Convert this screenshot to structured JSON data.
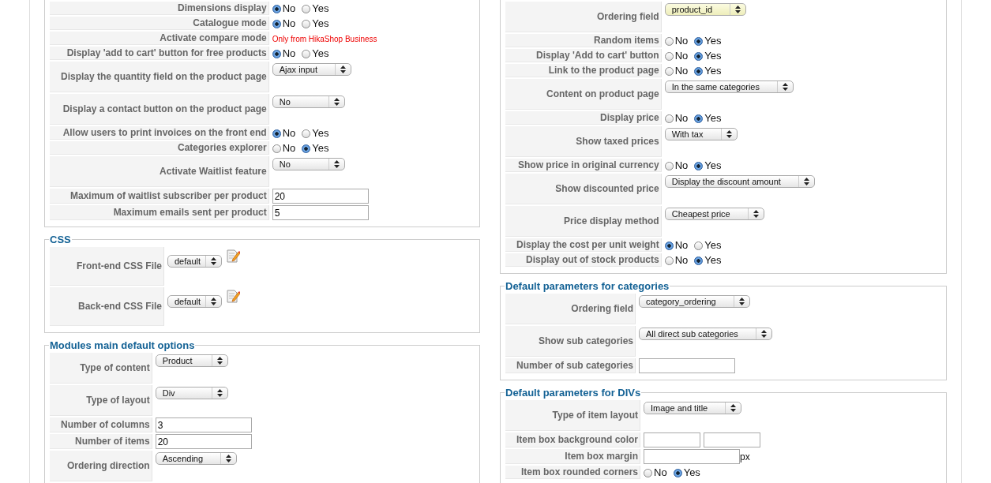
{
  "left": [
    {
      "rows": [
        {
          "kind": "radio",
          "label": "Dimensions display",
          "options": [
            {
              "label": "No",
              "selected": true
            },
            {
              "label": "Yes",
              "selected": false
            }
          ]
        },
        {
          "kind": "radio",
          "label": "Catalogue mode",
          "options": [
            {
              "label": "No",
              "selected": true
            },
            {
              "label": "Yes",
              "selected": false
            }
          ]
        },
        {
          "kind": "note",
          "label": "Activate compare mode",
          "note": "Only from HikaShop Business"
        },
        {
          "kind": "radio",
          "label": "Display 'add to cart' button for free products",
          "options": [
            {
              "label": "No",
              "selected": true
            },
            {
              "label": "Yes",
              "selected": false
            }
          ]
        },
        {
          "kind": "select",
          "label": "Display the quantity field on the product page",
          "value": "Ajax input"
        },
        {
          "kind": "select",
          "label": "Display a contact button on the product page",
          "value": "No"
        },
        {
          "kind": "radio",
          "label": "Allow users to print invoices on the front end",
          "options": [
            {
              "label": "No",
              "selected": true
            },
            {
              "label": "Yes",
              "selected": false
            }
          ]
        },
        {
          "kind": "radio",
          "label": "Categories explorer",
          "options": [
            {
              "label": "No",
              "selected": false
            },
            {
              "label": "Yes",
              "selected": true
            }
          ]
        },
        {
          "kind": "select",
          "label": "Activate Waitlist feature",
          "value": "No"
        },
        {
          "kind": "text",
          "label": "Maximum of waitlist subscriber per product",
          "value": "20"
        },
        {
          "kind": "text",
          "label": "Maximum emails sent per product",
          "value": "5"
        }
      ]
    },
    {
      "legend": "CSS",
      "rows": [
        {
          "kind": "css_file",
          "label": "Front-end CSS File",
          "value": "default"
        },
        {
          "kind": "css_file",
          "label": "Back-end CSS File",
          "value": "default"
        }
      ]
    },
    {
      "legend": "Modules main default options",
      "rows": [
        {
          "kind": "select",
          "label": "Type of content",
          "value": "Product"
        },
        {
          "kind": "select",
          "label": "Type of layout",
          "value": "Div"
        },
        {
          "kind": "text",
          "label": "Number of columns",
          "value": "3"
        },
        {
          "kind": "text",
          "label": "Number of items",
          "value": "20"
        },
        {
          "kind": "select",
          "label": "Ordering direction",
          "value": "Ascending"
        }
      ]
    }
  ],
  "right": [
    {
      "rows": [
        {
          "kind": "select",
          "label": "Ordering field",
          "value": "product_id",
          "highlighted": true
        },
        {
          "kind": "radio",
          "label": "Random items",
          "options": [
            {
              "label": "No",
              "selected": false
            },
            {
              "label": "Yes",
              "selected": true
            }
          ]
        },
        {
          "kind": "radio",
          "label": "Display 'Add to cart' button",
          "options": [
            {
              "label": "No",
              "selected": false
            },
            {
              "label": "Yes",
              "selected": true
            }
          ]
        },
        {
          "kind": "radio",
          "label": "Link to the product page",
          "options": [
            {
              "label": "No",
              "selected": false
            },
            {
              "label": "Yes",
              "selected": true
            }
          ]
        },
        {
          "kind": "select",
          "label": "Content on product page",
          "value": "In the same categories"
        },
        {
          "kind": "radio",
          "label": "Display price",
          "options": [
            {
              "label": "No",
              "selected": false
            },
            {
              "label": "Yes",
              "selected": true
            }
          ]
        },
        {
          "kind": "select",
          "label": "Show taxed prices",
          "value": "With tax"
        },
        {
          "kind": "radio",
          "label": "Show price in original currency",
          "options": [
            {
              "label": "No",
              "selected": false
            },
            {
              "label": "Yes",
              "selected": true
            }
          ]
        },
        {
          "kind": "select",
          "label": "Show discounted price",
          "value": "Display the discount amount"
        },
        {
          "kind": "select",
          "label": "Price display method",
          "value": "Cheapest price"
        },
        {
          "kind": "radio",
          "label": "Display the cost per unit weight",
          "options": [
            {
              "label": "No",
              "selected": true
            },
            {
              "label": "Yes",
              "selected": false
            }
          ]
        },
        {
          "kind": "radio",
          "label": "Display out of stock products",
          "options": [
            {
              "label": "No",
              "selected": false
            },
            {
              "label": "Yes",
              "selected": true
            }
          ]
        }
      ]
    },
    {
      "legend": "Default parameters for categories",
      "rows": [
        {
          "kind": "select",
          "label": "Ordering field",
          "value": "category_ordering"
        },
        {
          "kind": "select",
          "label": "Show sub categories",
          "value": "All direct sub categories"
        },
        {
          "kind": "text",
          "label": "Number of sub categories"
        }
      ]
    },
    {
      "legend": "Default parameters for DIVs",
      "rows": [
        {
          "kind": "select",
          "label": "Type of item layout",
          "value": "Image and title"
        },
        {
          "kind": "color_pair",
          "label": "Item box background color"
        },
        {
          "kind": "text_unit",
          "label": "Item box margin",
          "unit": "px"
        },
        {
          "kind": "radio",
          "label": "Item box rounded corners",
          "options": [
            {
              "label": "No",
              "selected": false
            },
            {
              "label": "Yes",
              "selected": true
            }
          ]
        }
      ]
    }
  ]
}
